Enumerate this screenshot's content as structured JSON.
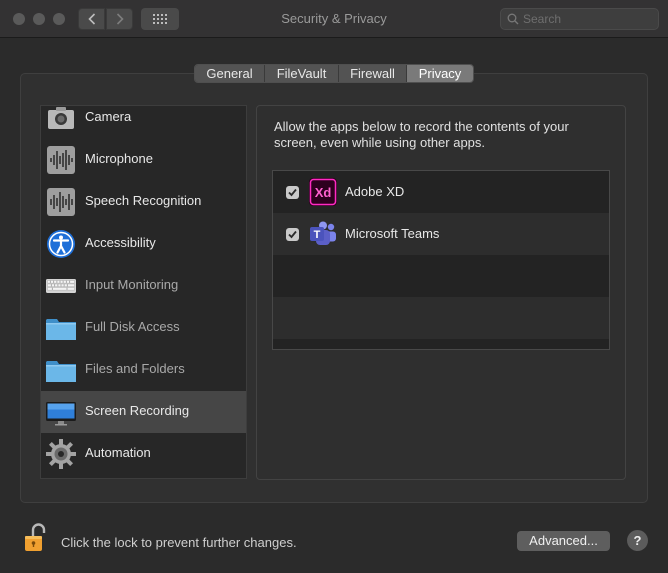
{
  "window": {
    "title": "Security & Privacy",
    "search_placeholder": "Search"
  },
  "tabs": [
    {
      "label": "General",
      "active": false
    },
    {
      "label": "FileVault",
      "active": false
    },
    {
      "label": "Firewall",
      "active": false
    },
    {
      "label": "Privacy",
      "active": true
    }
  ],
  "sidebar": {
    "items": [
      {
        "label": "Camera",
        "icon": "camera-icon",
        "selected": false,
        "dimmed": false
      },
      {
        "label": "Microphone",
        "icon": "microphone-waveform-icon",
        "selected": false,
        "dimmed": false
      },
      {
        "label": "Speech Recognition",
        "icon": "speech-waveform-icon",
        "selected": false,
        "dimmed": false
      },
      {
        "label": "Accessibility",
        "icon": "accessibility-icon",
        "selected": false,
        "dimmed": false
      },
      {
        "label": "Input Monitoring",
        "icon": "keyboard-icon",
        "selected": false,
        "dimmed": true
      },
      {
        "label": "Full Disk Access",
        "icon": "folder-icon",
        "selected": false,
        "dimmed": true
      },
      {
        "label": "Files and Folders",
        "icon": "folder-icon",
        "selected": false,
        "dimmed": true
      },
      {
        "label": "Screen Recording",
        "icon": "display-icon",
        "selected": true,
        "dimmed": false
      },
      {
        "label": "Automation",
        "icon": "gear-icon",
        "selected": false,
        "dimmed": false
      }
    ]
  },
  "content": {
    "description": "Allow the apps below to record the contents of your screen, even while using other apps.",
    "apps": [
      {
        "name": "Adobe XD",
        "checked": true,
        "icon": "adobe-xd-icon",
        "icon_text": "Xd"
      },
      {
        "name": "Microsoft Teams",
        "checked": true,
        "icon": "microsoft-teams-icon",
        "icon_text": "T"
      }
    ]
  },
  "footer": {
    "lock_text": "Click the lock to prevent further changes.",
    "advanced_label": "Advanced...",
    "help_label": "?"
  },
  "colors": {
    "window_bg": "#2b2b2b",
    "selected_row": "#464646",
    "xd_magenta": "#ff2bc2",
    "xd_bg": "#2e001f",
    "teams_purple": "#5b5fc7",
    "lock_orange": "#f0a030"
  }
}
